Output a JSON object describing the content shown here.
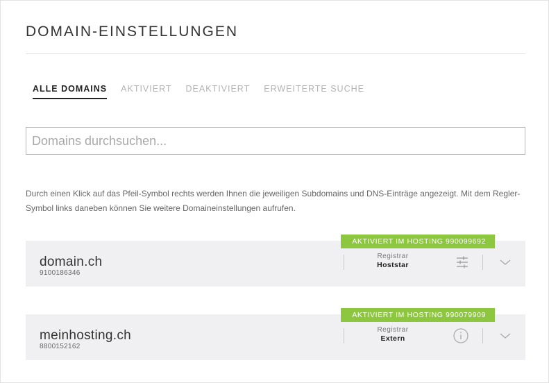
{
  "page": {
    "title": "DOMAIN-EINSTELLUNGEN"
  },
  "tabs": [
    {
      "label": "ALLE DOMAINS",
      "active": true
    },
    {
      "label": "AKTIVIERT",
      "active": false
    },
    {
      "label": "DEAKTIVIERT",
      "active": false
    },
    {
      "label": "ERWEITERTE SUCHE",
      "active": false
    }
  ],
  "search": {
    "placeholder": "Domains durchsuchen...",
    "value": ""
  },
  "help_text": "Durch einen Klick auf das Pfeil-Symbol rechts werden Ihnen die jeweiligen Subdomains und DNS-Einträge angezeigt. Mit dem Regler-Symbol links daneben können Sie weitere Domaineinstellungen aufrufen.",
  "domains": [
    {
      "name": "domain.ch",
      "id": "9100186346",
      "status": "AKTIVIERT IM HOSTING 990099692",
      "registrar_label": "Registrar",
      "registrar_value": "Hoststar",
      "action_icon": "sliders-icon"
    },
    {
      "name": "meinhosting.ch",
      "id": "8800152162",
      "status": "AKTIVIERT IM HOSTING 990079909",
      "registrar_label": "Registrar",
      "registrar_value": "Extern",
      "action_icon": "info-icon"
    }
  ],
  "colors": {
    "status_badge": "#8dc63f",
    "card_background": "#f0f0f3",
    "active_tab": "#222222",
    "inactive_tab": "#b3b3b3"
  }
}
